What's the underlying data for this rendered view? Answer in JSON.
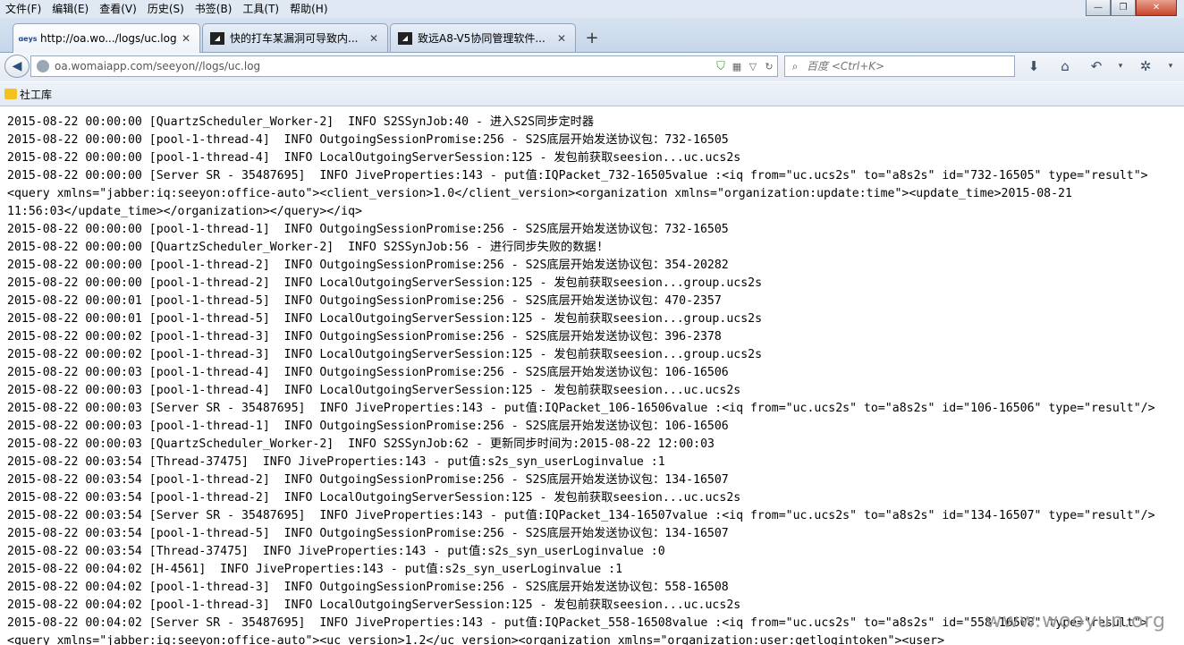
{
  "menu": [
    "文件(F)",
    "编辑(E)",
    "查看(V)",
    "历史(S)",
    "书签(B)",
    "工具(T)",
    "帮助(H)"
  ],
  "window_controls": {
    "minimize": "—",
    "maximize": "❐",
    "close": "✕"
  },
  "tabs": [
    {
      "label": "http://oa.wo.../logs/uc.log",
      "favicon": "seeyon-favicon",
      "favicon_text": "ɑeys"
    },
    {
      "label": "快的打车某漏洞可导致内...",
      "favicon": "wooyun-favicon",
      "favicon_text": "◢"
    },
    {
      "label": "致远A8-V5协同管理软件...",
      "favicon": "wooyun-favicon",
      "favicon_text": "◢"
    }
  ],
  "new_tab": "+",
  "nav": {
    "url": "oa.womaiapp.com/seeyon//logs/uc.log",
    "search_placeholder": "百度 <Ctrl+K>",
    "back": "◀",
    "icons": [
      "download-icon",
      "home-icon",
      "undo-icon",
      "menu-icon"
    ]
  },
  "bookmarks": [
    {
      "label": "社工库"
    }
  ],
  "log_lines": [
    "2015-08-22 00:00:00 [QuartzScheduler_Worker-2]  INFO S2SSynJob:40 - 进入S2S同步定时器",
    "2015-08-22 00:00:00 [pool-1-thread-4]  INFO OutgoingSessionPromise:256 - S2S底层开始发送协议包：732-16505",
    "2015-08-22 00:00:00 [pool-1-thread-4]  INFO LocalOutgoingServerSession:125 - 发包前获取seesion...uc.ucs2s",
    "2015-08-22 00:00:00 [Server SR - 35487695]  INFO JiveProperties:143 - put值:IQPacket_732-16505value :<iq from=\"uc.ucs2s\" to=\"a8s2s\" id=\"732-16505\" type=\"result\">",
    "<query xmlns=\"jabber:iq:seeyon:office-auto\"><client_version>1.0</client_version><organization xmlns=\"organization:update:time\"><update_time>2015-08-21",
    "11:56:03</update_time></organization></query></iq>",
    "2015-08-22 00:00:00 [pool-1-thread-1]  INFO OutgoingSessionPromise:256 - S2S底层开始发送协议包：732-16505",
    "2015-08-22 00:00:00 [QuartzScheduler_Worker-2]  INFO S2SSynJob:56 - 进行同步失败的数据!",
    "2015-08-22 00:00:00 [pool-1-thread-2]  INFO OutgoingSessionPromise:256 - S2S底层开始发送协议包：354-20282",
    "2015-08-22 00:00:00 [pool-1-thread-2]  INFO LocalOutgoingServerSession:125 - 发包前获取seesion...group.ucs2s",
    "2015-08-22 00:00:01 [pool-1-thread-5]  INFO OutgoingSessionPromise:256 - S2S底层开始发送协议包：470-2357",
    "2015-08-22 00:00:01 [pool-1-thread-5]  INFO LocalOutgoingServerSession:125 - 发包前获取seesion...group.ucs2s",
    "2015-08-22 00:00:02 [pool-1-thread-3]  INFO OutgoingSessionPromise:256 - S2S底层开始发送协议包：396-2378",
    "2015-08-22 00:00:02 [pool-1-thread-3]  INFO LocalOutgoingServerSession:125 - 发包前获取seesion...group.ucs2s",
    "2015-08-22 00:00:03 [pool-1-thread-4]  INFO OutgoingSessionPromise:256 - S2S底层开始发送协议包：106-16506",
    "2015-08-22 00:00:03 [pool-1-thread-4]  INFO LocalOutgoingServerSession:125 - 发包前获取seesion...uc.ucs2s",
    "2015-08-22 00:00:03 [Server SR - 35487695]  INFO JiveProperties:143 - put值:IQPacket_106-16506value :<iq from=\"uc.ucs2s\" to=\"a8s2s\" id=\"106-16506\" type=\"result\"/>",
    "2015-08-22 00:00:03 [pool-1-thread-1]  INFO OutgoingSessionPromise:256 - S2S底层开始发送协议包：106-16506",
    "2015-08-22 00:00:03 [QuartzScheduler_Worker-2]  INFO S2SSynJob:62 - 更新同步时间为:2015-08-22 12:00:03",
    "2015-08-22 00:03:54 [Thread-37475]  INFO JiveProperties:143 - put值:s2s_syn_userLoginvalue :1",
    "2015-08-22 00:03:54 [pool-1-thread-2]  INFO OutgoingSessionPromise:256 - S2S底层开始发送协议包：134-16507",
    "2015-08-22 00:03:54 [pool-1-thread-2]  INFO LocalOutgoingServerSession:125 - 发包前获取seesion...uc.ucs2s",
    "2015-08-22 00:03:54 [Server SR - 35487695]  INFO JiveProperties:143 - put值:IQPacket_134-16507value :<iq from=\"uc.ucs2s\" to=\"a8s2s\" id=\"134-16507\" type=\"result\"/>",
    "2015-08-22 00:03:54 [pool-1-thread-5]  INFO OutgoingSessionPromise:256 - S2S底层开始发送协议包：134-16507",
    "2015-08-22 00:03:54 [Thread-37475]  INFO JiveProperties:143 - put值:s2s_syn_userLoginvalue :0",
    "2015-08-22 00:04:02 [H-4561]  INFO JiveProperties:143 - put值:s2s_syn_userLoginvalue :1",
    "2015-08-22 00:04:02 [pool-1-thread-3]  INFO OutgoingSessionPromise:256 - S2S底层开始发送协议包：558-16508",
    "2015-08-22 00:04:02 [pool-1-thread-3]  INFO LocalOutgoingServerSession:125 - 发包前获取seesion...uc.ucs2s",
    "2015-08-22 00:04:02 [Server SR - 35487695]  INFO JiveProperties:143 - put值:IQPacket_558-16508value :<iq from=\"uc.ucs2s\" to=\"a8s2s\" id=\"558-16508\" type=\"result\">",
    "<query xmlns=\"jabber:iq:seeyon:office-auto\"><uc_version>1.2</uc_version><organization xmlns=\"organization:user:getlogintoken\"><user>"
  ],
  "watermark": "www.wooyun.org"
}
